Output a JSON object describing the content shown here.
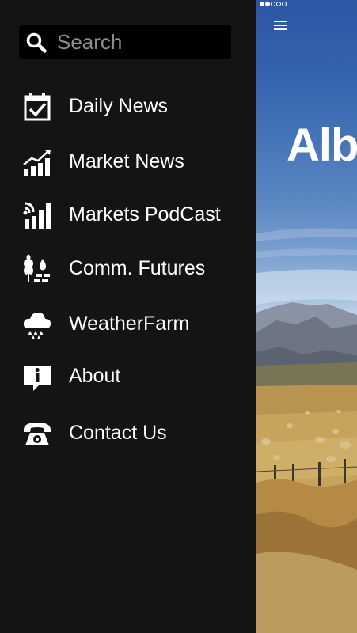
{
  "search": {
    "placeholder": "Search",
    "icon": "search-icon"
  },
  "menu": [
    {
      "label": "Daily News",
      "icon": "calendar-check-icon"
    },
    {
      "label": "Market News",
      "icon": "chart-trend-icon"
    },
    {
      "label": "Markets PodCast",
      "icon": "podcast-bars-icon"
    },
    {
      "label": "Comm. Futures",
      "icon": "grain-commodity-icon"
    },
    {
      "label": "WeatherFarm",
      "icon": "rain-cloud-icon"
    },
    {
      "label": "About",
      "icon": "info-bubble-icon"
    },
    {
      "label": "Contact Us",
      "icon": "telephone-icon"
    }
  ],
  "main": {
    "brand_text": "Alb",
    "page_dots": {
      "total": 5,
      "active": [
        0,
        1
      ]
    },
    "menu_icon": "hamburger-icon"
  },
  "colors": {
    "drawer_bg": "#141414",
    "search_bg": "#000000",
    "text": "#ffffff",
    "placeholder": "#8e8e8e"
  }
}
